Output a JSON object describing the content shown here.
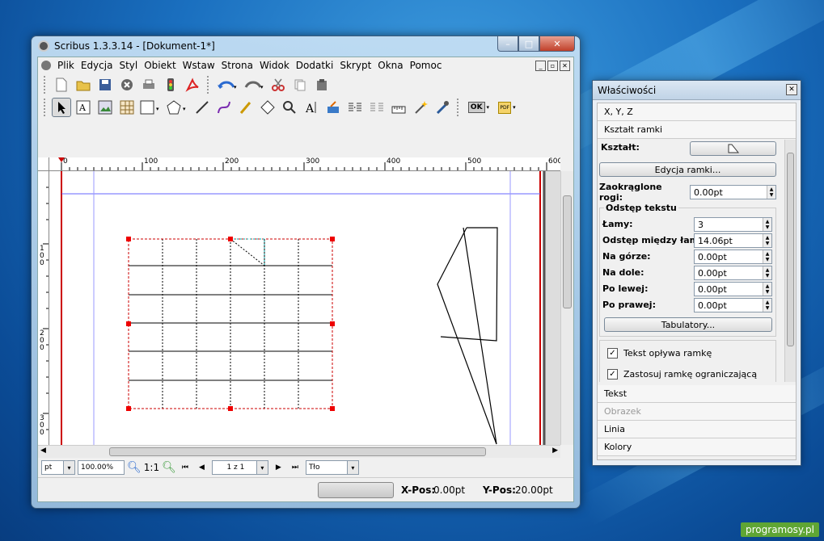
{
  "window": {
    "title": "Scribus 1.3.3.14 - [Dokument-1*]",
    "min": "–",
    "max": "□",
    "close": "✕"
  },
  "menu": [
    "Plik",
    "Edycja",
    "Styl",
    "Obiekt",
    "Wstaw",
    "Strona",
    "Widok",
    "Dodatki",
    "Skrypt",
    "Okna",
    "Pomoc"
  ],
  "toolbar_icons": {
    "row1": [
      "new-document-icon",
      "open-folder-icon",
      "save-icon",
      "close-doc-icon",
      "print-icon",
      "preflight-icon",
      "pdf-export-icon",
      "undo-icon",
      "redo-icon",
      "cut-icon",
      "copy-icon",
      "paste-icon"
    ],
    "row2": [
      "select-arrow-icon",
      "text-frame-icon",
      "image-frame-icon",
      "table-icon",
      "shape-icon",
      "polygon-icon",
      "line-icon",
      "bezier-icon",
      "freehand-icon",
      "rotate-icon",
      "zoom-icon",
      "edit-text-icon",
      "link-text-icon",
      "unlink-text-icon",
      "measure-icon",
      "eyedropper-icon",
      "ok-icon",
      "pdf-tools-icon"
    ]
  },
  "ruler": {
    "h_labels": [
      "0",
      "100",
      "200",
      "300",
      "400",
      "500",
      "600"
    ],
    "v_labels": [
      "100",
      "200",
      "300"
    ]
  },
  "status": {
    "unit": "pt",
    "zoom": "100.00%",
    "ratio": "1:1",
    "page": "1 z 1",
    "layer": "Tło",
    "xpos_label": "X-Pos:",
    "xpos": "0.00pt",
    "ypos_label": "Y-Pos:",
    "ypos": "20.00pt"
  },
  "panel": {
    "title": "Właściwości",
    "sections_top": [
      "X, Y, Z",
      "Kształt ramki"
    ],
    "shape_label": "Kształt:",
    "edit_frame_btn": "Edycja ramki...",
    "rounded_label": "Zaokrąglone rogi:",
    "rounded_value": "0.00pt",
    "text_distance_title": "Odstęp tekstu",
    "fields": [
      {
        "label": "Łamy:",
        "value": "3"
      },
      {
        "label": "Odstęp między łamami:",
        "value": "14.06pt"
      },
      {
        "label": "Na górze:",
        "value": "0.00pt"
      },
      {
        "label": "Na dole:",
        "value": "0.00pt"
      },
      {
        "label": "Po lewej:",
        "value": "0.00pt"
      },
      {
        "label": "Po prawej:",
        "value": "0.00pt"
      }
    ],
    "tabs_btn": "Tabulatory...",
    "checks": [
      {
        "label": "Tekst opływa ramkę",
        "checked": true
      },
      {
        "label": "Zastosuj ramkę ograniczającą",
        "checked": true
      }
    ],
    "sections_bottom": [
      {
        "label": "Tekst",
        "disabled": false
      },
      {
        "label": "Obrazek",
        "disabled": true
      },
      {
        "label": "Linia",
        "disabled": false
      },
      {
        "label": "Kolory",
        "disabled": false
      }
    ]
  },
  "watermark": "programosy.pl"
}
